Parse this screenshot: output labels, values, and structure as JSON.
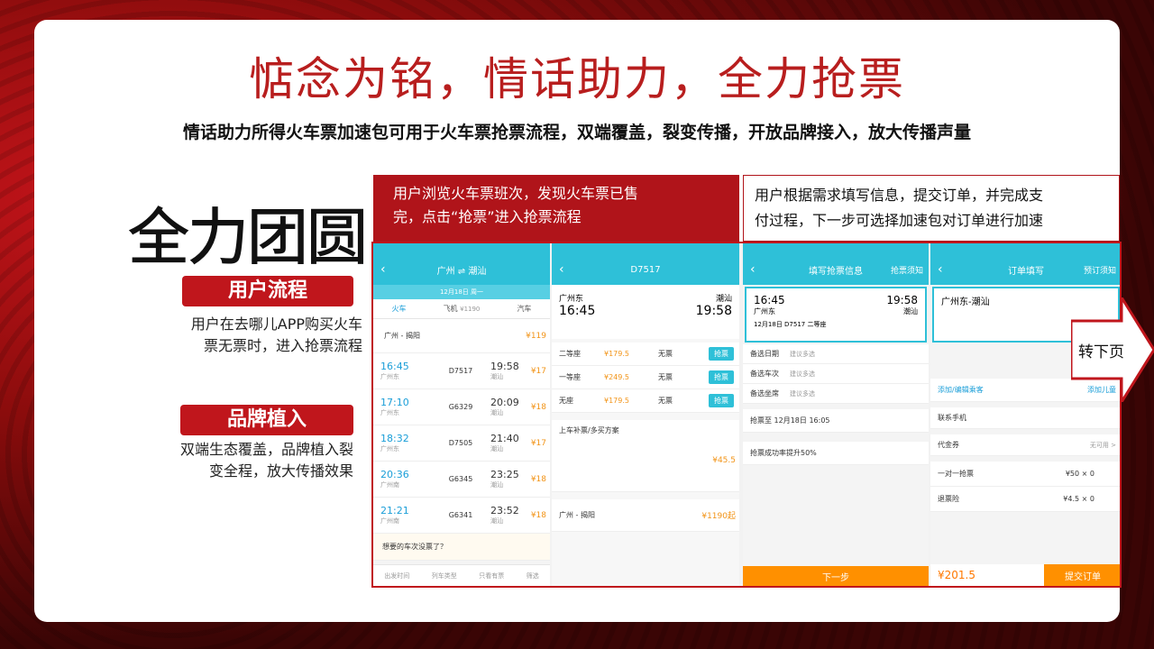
{
  "title": "惦念为铭，情话助力，全力抢票",
  "subtitle": "情话助力所得火车票加速包可用于火车票抢票流程，双端覆盖，裂变传播，开放品牌接入，放大传播声量",
  "slogan": "全力团圆",
  "sections": [
    {
      "label": "用户流程",
      "desc_line1": "用户在去哪儿APP购买火车",
      "desc_line2": "票无票时，进入抢票流程"
    },
    {
      "label": "品牌植入",
      "desc_line1": "双端生态覆盖，品牌植入裂",
      "desc_line2": "变全程，放大传播效果"
    }
  ],
  "captions": {
    "left_line1": "用户浏览火车票班次，发现火车票已售",
    "left_line2": "完，点击“抢票”进入抢票流程",
    "right_line1": "用户根据需求填写信息，提交订单，并完成支",
    "right_line2": "付过程，下一步可选择加速包对订单进行加速"
  },
  "next_page": "转下页",
  "screen1": {
    "nav_title": "广州 ⇌ 潮汕",
    "date": "12月18日 周一",
    "tabs": [
      "火车",
      "飞机",
      "汽车"
    ],
    "plane_price": "¥1190",
    "top_route": "广州 - 揭阳",
    "top_price": "¥119",
    "trains": [
      {
        "dep": "16:45",
        "from": "广州东",
        "no": "D7517",
        "arr": "19:58",
        "to": "潮汕",
        "price": "¥17"
      },
      {
        "dep": "17:10",
        "from": "广州东",
        "no": "G6329",
        "arr": "20:09",
        "to": "潮汕",
        "price": "¥18"
      },
      {
        "dep": "18:32",
        "from": "广州东",
        "no": "D7505",
        "arr": "21:40",
        "to": "潮汕",
        "price": "¥17"
      },
      {
        "dep": "20:36",
        "from": "广州南",
        "no": "G6345",
        "arr": "23:25",
        "to": "潮汕",
        "price": "¥18"
      },
      {
        "dep": "21:21",
        "from": "广州南",
        "no": "G6341",
        "arr": "23:52",
        "to": "潮汕",
        "price": "¥18"
      }
    ],
    "tip": "想要的车次没票了？",
    "footer": [
      "出发时间",
      "列车类型",
      "只看有票",
      "筛选"
    ]
  },
  "screen2": {
    "nav_title": "D7517",
    "from": "广州东",
    "to": "潮汕",
    "dep": "16:45",
    "arr": "19:58",
    "seats": [
      {
        "name": "二等座",
        "price": "¥179.5",
        "status": "无票",
        "action": "抢票"
      },
      {
        "name": "一等座",
        "price": "¥249.5",
        "status": "无票",
        "action": "抢票"
      },
      {
        "name": "无座",
        "price": "¥179.5",
        "status": "无票",
        "action": "抢票"
      }
    ],
    "combo": "上车补票/多买方案",
    "combo_price": "¥45.5",
    "bottom_route": "广州 - 揭阳",
    "bottom_price": "¥1190起"
  },
  "screen3": {
    "nav_title": "填写抢票信息",
    "nav_right": "抢票须知",
    "dep": "16:45",
    "from": "广州东",
    "arr": "19:58",
    "to": "潮汕",
    "date_line": "12月18日  D7517  二等座",
    "fields": [
      {
        "label": "备选日期",
        "value": "建议多选"
      },
      {
        "label": "备选车次",
        "value": "建议多选"
      },
      {
        "label": "备选坐席",
        "value": "建议多选"
      }
    ],
    "deadline": "抢票至    12月18日 16:05",
    "speed": "抢票成功率提升50%",
    "next_button": "下一步"
  },
  "screen4": {
    "nav_title": "订单填写",
    "nav_right": "预订须知",
    "route": "广州东-潮汕",
    "add_passenger": "添加/编辑乘客",
    "add_child": "添加儿童",
    "contact": "联系手机",
    "coupon": "代金券",
    "coupon_value": "无可用 >",
    "services": [
      {
        "label": "一对一抢票",
        "price": "¥50 × 0"
      },
      {
        "label": "退票险",
        "price": "¥4.5 × 0"
      }
    ],
    "total": "¥201.5",
    "submit": "提交订单"
  },
  "colors": {
    "brand_red": "#c0161c",
    "teal": "#2ec0d8",
    "orange": "#ff9000"
  }
}
